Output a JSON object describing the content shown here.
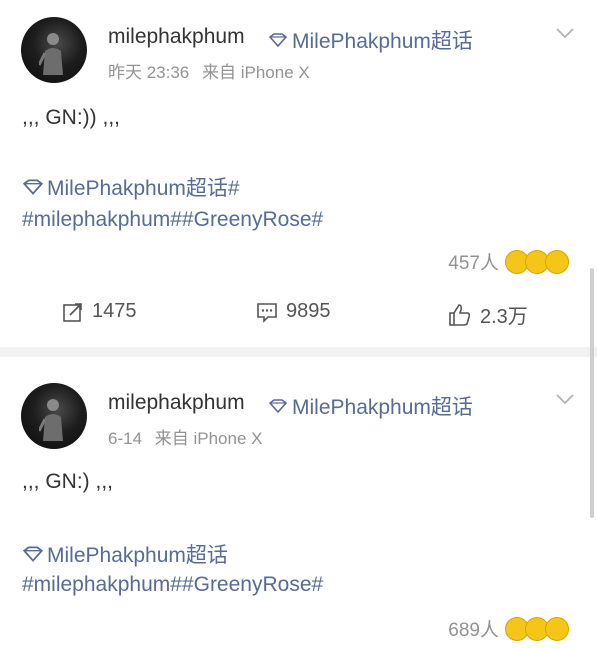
{
  "posts": [
    {
      "username": "milephakphum",
      "super_topic": "MilePhakphum超话",
      "time": "昨天 23:36",
      "source": "来自 iPhone X",
      "body": ",,, GN:)) ,,,",
      "topic_link": "MilePhakphum超话#",
      "hashtags": "#milephakphum##GreenyRose#",
      "likers": "457人",
      "reposts": "1475",
      "comments": "9895",
      "likes": "2.3万"
    },
    {
      "username": "milephakphum",
      "super_topic": "MilePhakphum超话",
      "time": "6-14",
      "source": "来自 iPhone X",
      "body": ",,, GN:) ,,,",
      "topic_link": "MilePhakphum超话",
      "hashtags": "#milephakphum##GreenyRose#",
      "likers": "689人"
    }
  ],
  "icons": {
    "super_topic": "diamond-icon",
    "menu": "chevron-down-icon",
    "repost": "repost-icon",
    "comment": "comment-icon",
    "like": "thumbs-up-icon"
  },
  "colors": {
    "link": "#576b95",
    "meta": "#939393",
    "separator": "#f2f2f2"
  }
}
